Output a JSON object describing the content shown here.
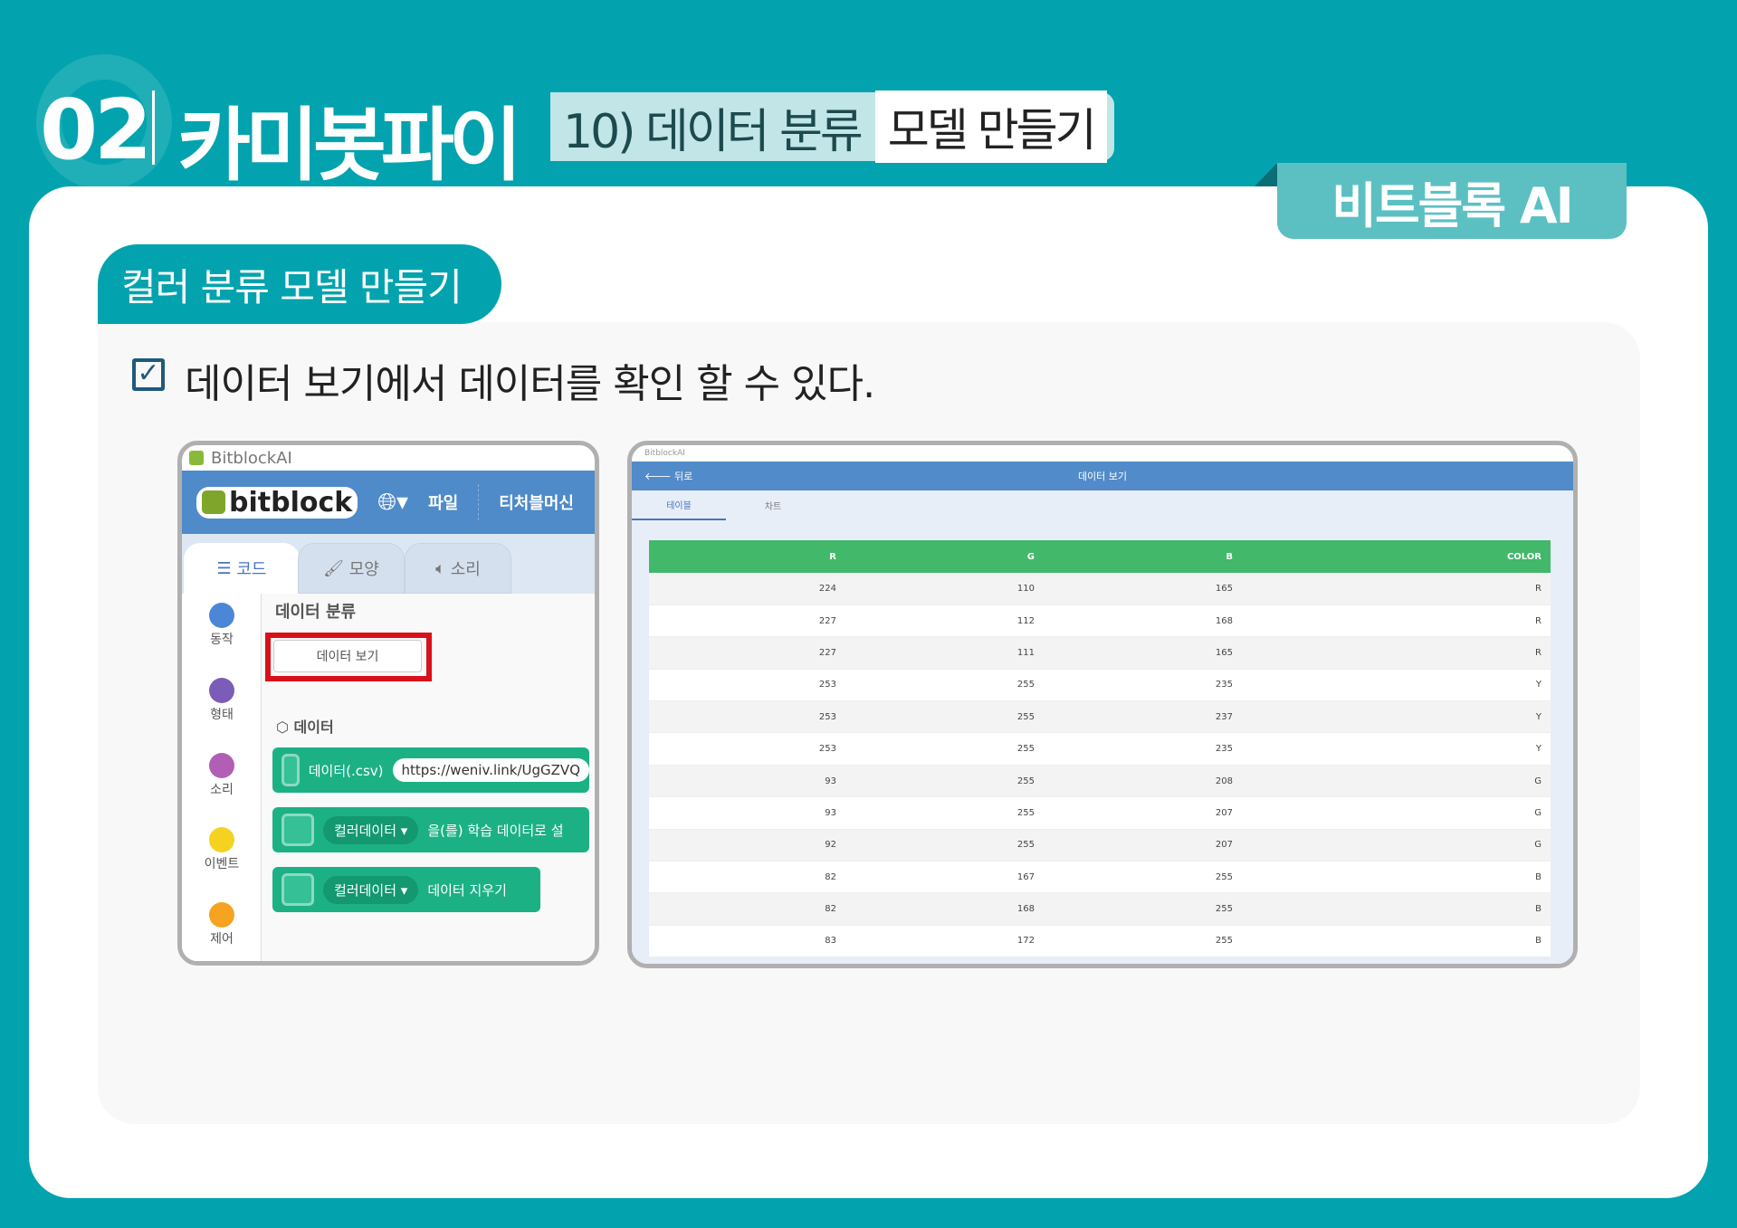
{
  "header": {
    "chapter": "02",
    "title": "카미봇파이",
    "section": "10) 데이터 분류",
    "section_highlight": "모델 만들기",
    "badge": "비트블록 AI"
  },
  "topic": {
    "pill": "컬러 분류 모델 만들기",
    "goal": "데이터 보기에서 데이터를 확인 할 수 있다."
  },
  "left_app": {
    "window_title": "BitblockAI",
    "logo": "bitblock",
    "menu": [
      "파일",
      "티처블머신"
    ],
    "tabs": [
      "코드",
      "모양",
      "소리"
    ],
    "categories": [
      {
        "label": "동작",
        "color": "#4c86d6"
      },
      {
        "label": "형태",
        "color": "#7b5cb8"
      },
      {
        "label": "소리",
        "color": "#b15eb5"
      },
      {
        "label": "이벤트",
        "color": "#f5d21f"
      },
      {
        "label": "제어",
        "color": "#f5a321"
      }
    ],
    "heading": "데이터 분류",
    "view_button": "데이터 보기",
    "data_section": "데이터",
    "blocks": {
      "csv_label": "데이터(.csv)",
      "csv_url": "https://weniv.link/UgGZVQ",
      "dataset": "컬러데이터",
      "train_text": "을(를) 학습 데이터로 설",
      "clear_text": "데이터 지우기"
    },
    "highlight_color": "#d9101a"
  },
  "right_app": {
    "window_title": "BitblockAI",
    "back": "뒤로",
    "title": "데이터 보기",
    "tabs": [
      "테이블",
      "차트"
    ],
    "columns": [
      "R",
      "G",
      "B",
      "COLOR"
    ],
    "rows": [
      [
        "224",
        "110",
        "165",
        "R"
      ],
      [
        "227",
        "112",
        "168",
        "R"
      ],
      [
        "227",
        "111",
        "165",
        "R"
      ],
      [
        "253",
        "255",
        "235",
        "Y"
      ],
      [
        "253",
        "255",
        "237",
        "Y"
      ],
      [
        "253",
        "255",
        "235",
        "Y"
      ],
      [
        "93",
        "255",
        "208",
        "G"
      ],
      [
        "93",
        "255",
        "207",
        "G"
      ],
      [
        "92",
        "255",
        "207",
        "G"
      ],
      [
        "82",
        "167",
        "255",
        "B"
      ],
      [
        "82",
        "168",
        "255",
        "B"
      ],
      [
        "83",
        "172",
        "255",
        "B"
      ]
    ]
  }
}
